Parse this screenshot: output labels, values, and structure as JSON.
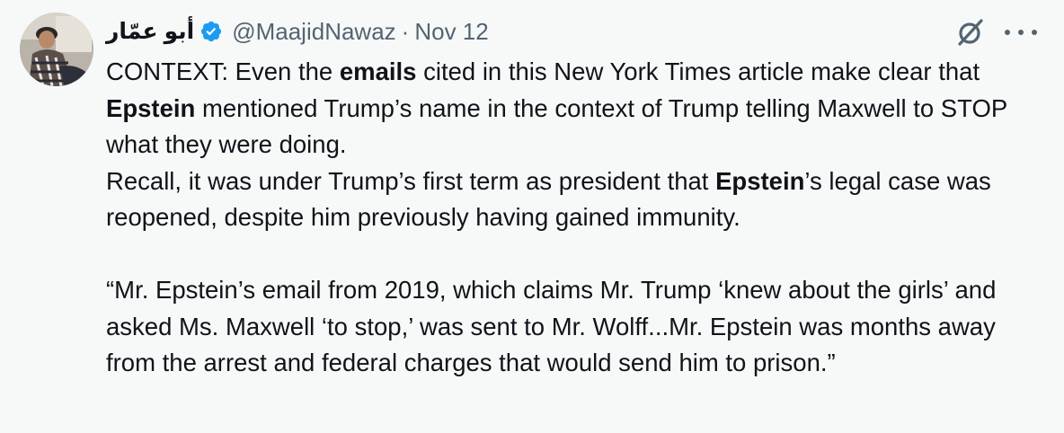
{
  "tweet": {
    "display_name": "أبو عمّار",
    "handle": "@MaajidNawaz",
    "separator": "·",
    "timestamp": "Nov 12",
    "verified_icon": "verified-badge-icon",
    "grok_icon": "grok-icon",
    "more_icon": "more-options-icon",
    "colors": {
      "verified": "#1d9bf0",
      "secondary_text": "#536471",
      "primary_text": "#0f1419",
      "background": "#f7f9f9"
    },
    "text": {
      "p1": {
        "a": "CONTEXT: Even the ",
        "b1": "emails",
        "c": " cited in this New York Times article make clear that ",
        "b2": "Epstein",
        "d": " mentioned Trump’s name in the context of Trump telling Maxwell to STOP what they were doing."
      },
      "p2": {
        "a": "Recall, it was under Trump’s first term as president that ",
        "b1": "Epstein",
        "c": "’s legal case was reopened, despite him previously having gained immunity."
      },
      "quote": "“Mr. Epstein’s email from 2019, which claims Mr. Trump ‘knew about the girls’ and asked Ms. Maxwell ‘to stop,’ was sent to Mr. Wolff...Mr. Epstein was months away from the arrest and federal charges that would send him to prison.”"
    }
  }
}
